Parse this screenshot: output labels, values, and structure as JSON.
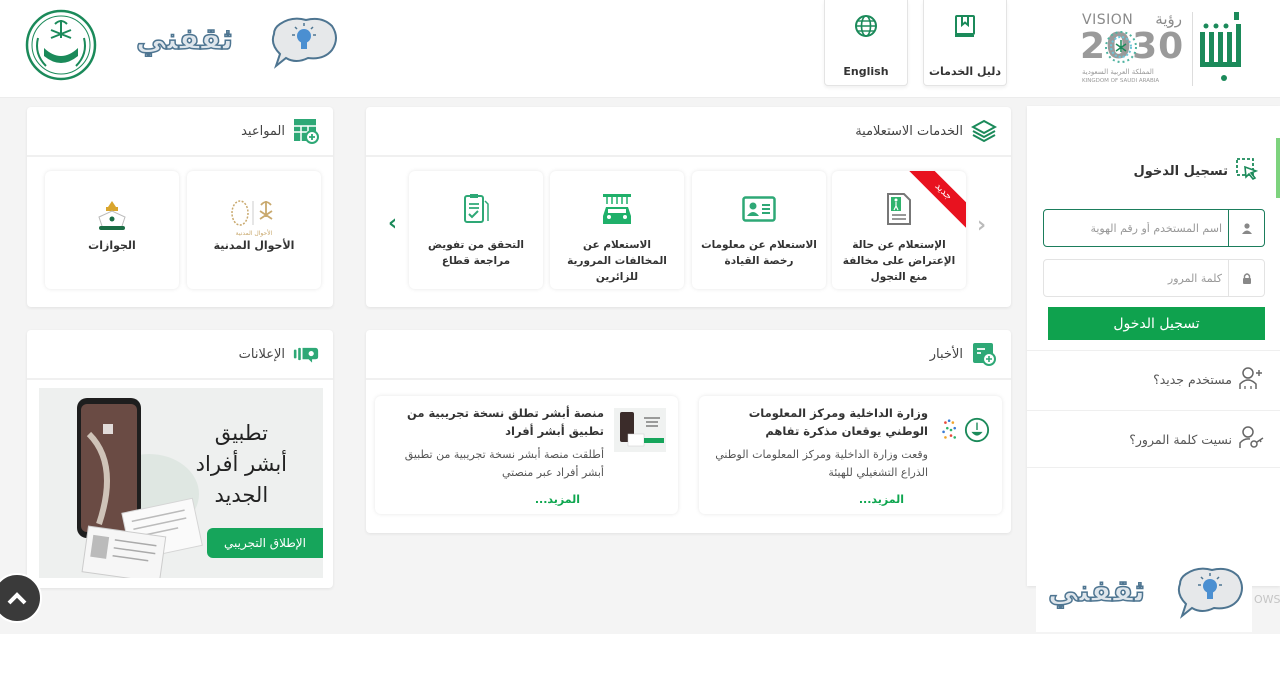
{
  "header": {
    "brand_logo": "absher-logo",
    "vision": {
      "title_en": "VISION",
      "title_ar": "رؤية",
      "year": "2030",
      "subtitle_ar": "المملكة العربية السعودية",
      "subtitle_en": "KINGDOM OF SAUDI ARABIA"
    },
    "buttons": [
      {
        "label": "دليل الخدمات",
        "icon": "book-icon"
      },
      {
        "label": "English",
        "icon": "globe-icon"
      }
    ],
    "watermark": "ثقفني",
    "emblem": "ministry-of-interior-emblem"
  },
  "colors": {
    "brand_green": "#1b8a5a",
    "button_green": "#0fa24e",
    "link_green": "#0ea64f",
    "ribbon_red": "#e8121f",
    "page_bg": "#f4f4f4",
    "accent_light_green": "#7ed37e"
  },
  "login": {
    "title": "تسجيل الدخول",
    "username_placeholder": "اسم المستخدم أو رقم الهوية",
    "username_value": "",
    "password_placeholder": "كلمة المرور",
    "password_value": "",
    "submit_label": "تسجيل الدخول",
    "new_user_label": "مستخدم جديد؟",
    "forgot_password_label": "نسيت كلمة المرور؟"
  },
  "inquiry_services": {
    "title": "الخدمات الاستعلامية",
    "items": [
      {
        "label": "الإستعلام عن حالة الإعتراض على مخالفة منع التجول",
        "badge": "جديد"
      },
      {
        "label": "الاستعلام عن معلومات رخصة القيادة"
      },
      {
        "label": "الاستعلام عن المخالفات المرورية للزائرين"
      },
      {
        "label": "التحقق من تفويض مراجعة قطاع"
      }
    ]
  },
  "appointments": {
    "title": "المواعيد",
    "items": [
      {
        "label": "الأحوال المدنية",
        "logo_caption": "الأحوال المدنية"
      },
      {
        "label": "الجوازات"
      }
    ]
  },
  "news": {
    "title": "الأخبار",
    "items": [
      {
        "title": "وزارة الداخلية ومركز المعلومات الوطني يوقعان مذكرة تفاهم",
        "body": "وقعت وزارة الداخلية ومركز المعلومات الوطني الذراع التشغيلي للهيئة",
        "more": "المزيد..."
      },
      {
        "title": "منصة أبشر تطلق نسخة تجريبية من تطبيق أبشر أفراد",
        "body": "أطلقت منصة أبشر نسخة تجريبية من تطبيق أبشر أفراد عبر منصتي",
        "more": "المزيد..."
      }
    ]
  },
  "ads": {
    "title": "الإعلانات",
    "banner_line1": "تطبيق",
    "banner_line2": "أبشر أفراد",
    "banner_line3": "الجديد",
    "banner_button": "الإطلاق التجريبي"
  },
  "footer": {
    "watermark": "ثقفني",
    "partial_text": "OWS."
  }
}
